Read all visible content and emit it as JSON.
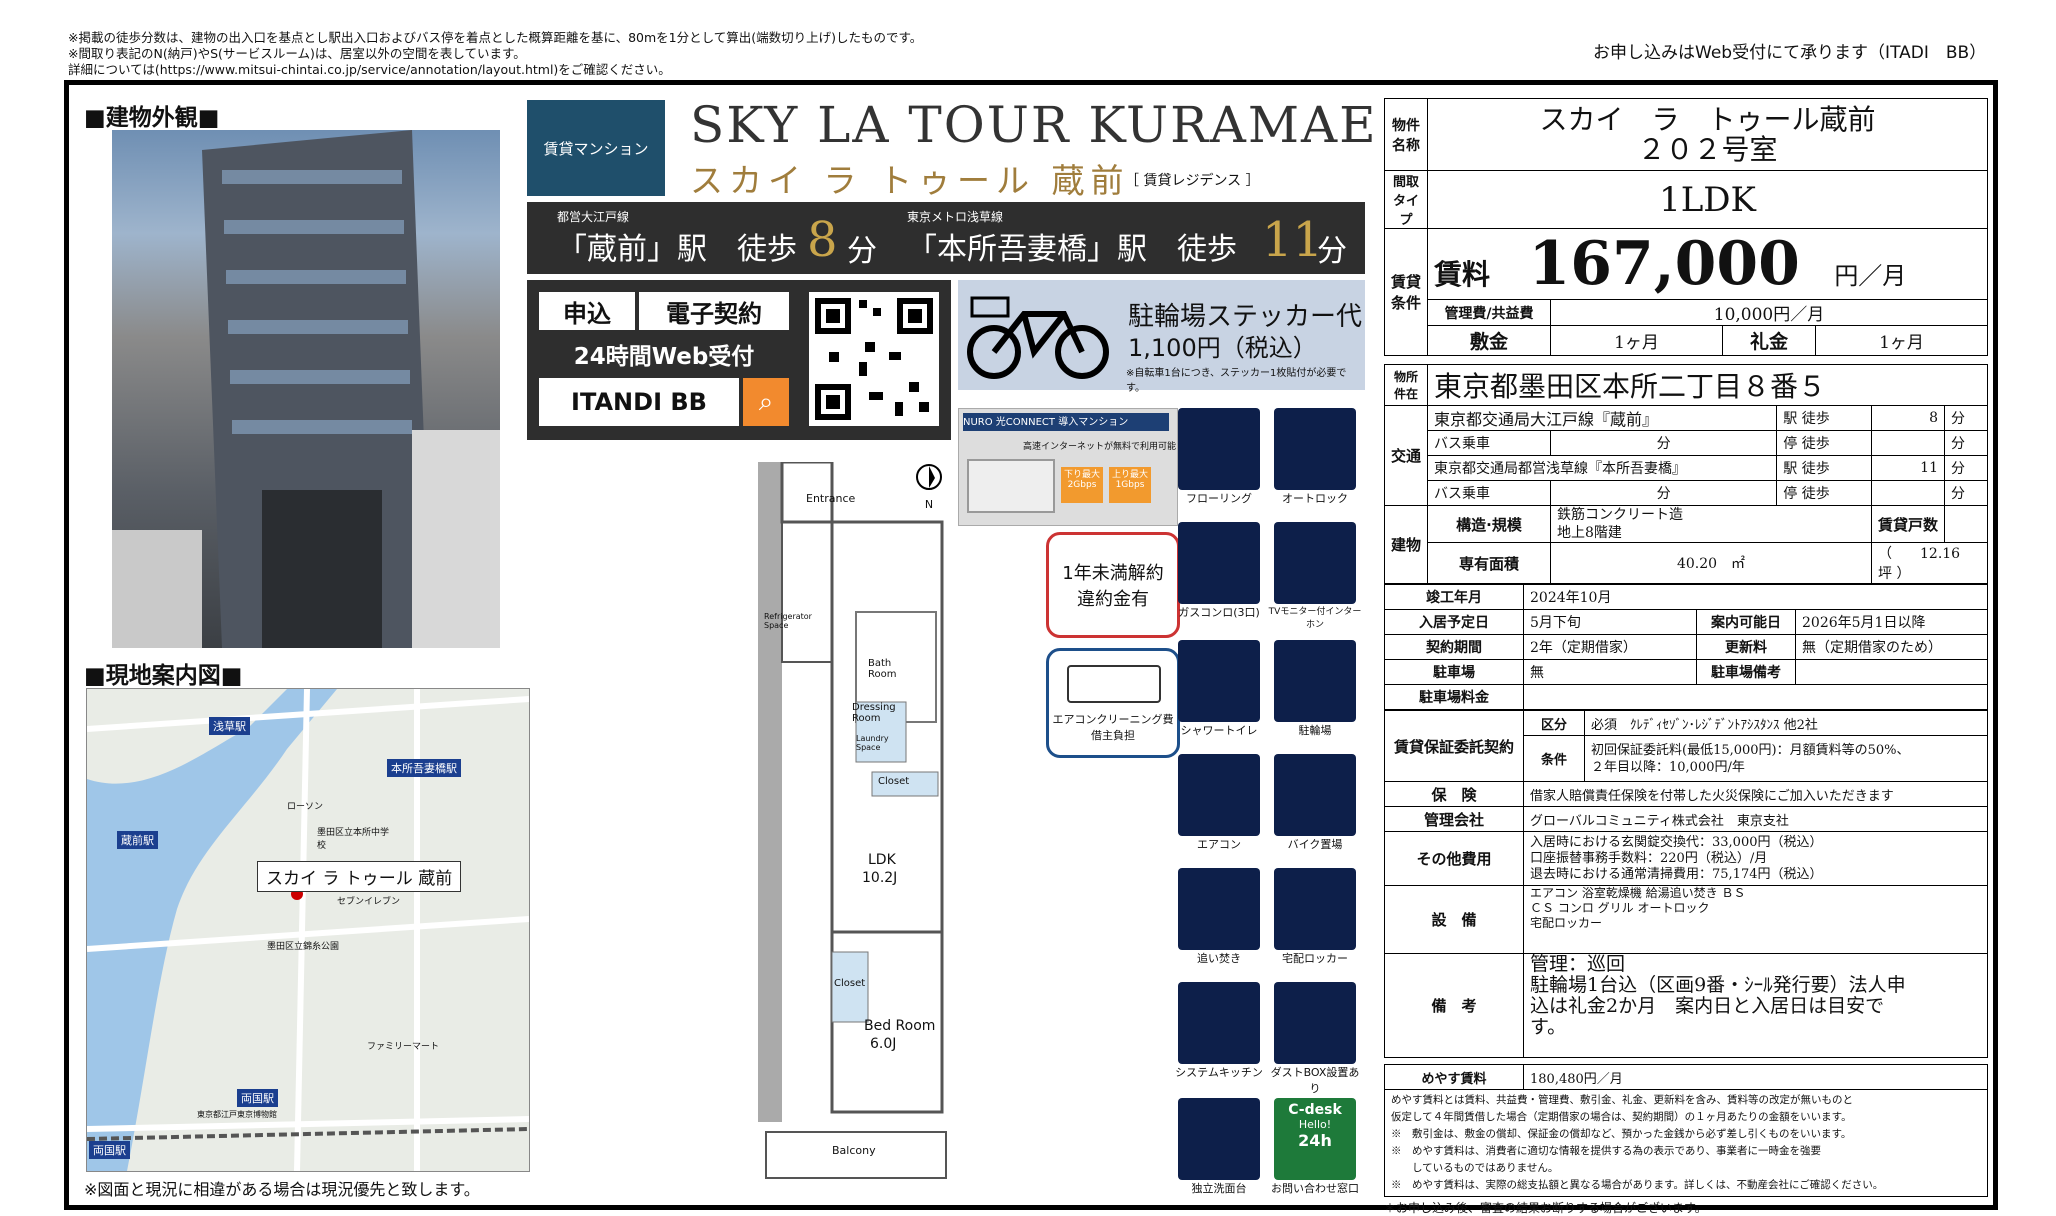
{
  "top_notes": [
    "※掲載の徒歩分数は、建物の出入口を基点とし駅出入口およびバス停を着点とした概算距離を基に、80mを1分として算出(端数切り上げ)したものです。",
    "※間取り表記のN(納戸)やS(サービスルーム)は、居室以外の空間を表しています。",
    "詳細については(https://www.mitsui-chintai.co.jp/service/annotation/layout.html)をご確認ください。"
  ],
  "top_right": "お申し込みはWeb受付にて承ります（ITADI　BB）",
  "exterior_heading": "■建物外観■",
  "map_heading": "■現地案内図■",
  "map_footnote": "※図面と現況に相違がある場合は現況優先と致します。",
  "map_labels": {
    "asakusabashi": "浅草駅",
    "honjo": "本所吾妻橋駅",
    "kuramae": "蔵前駅",
    "ryogoku1": "両国駅",
    "ryogoku2": "両国駅",
    "building": "スカイ ラ トゥール 蔵前",
    "school": "墨田区立本所中学校",
    "park": "墨田区立錦糸公園",
    "lawson": "ローソン",
    "family": "ファミリーマート",
    "seven": "セブンイレブン",
    "museum": "東京都江戸東京博物館"
  },
  "brand": {
    "tag": "賃貸マンション",
    "title_en": "SKY LA TOUR KURAMAE",
    "title_jp": "スカイ ラ トゥール 蔵前",
    "residence": "［ 賃貸レジデンス ］"
  },
  "access_bar": {
    "line1_small": "都営大江戸線",
    "line1": "「蔵前」駅　徒歩",
    "min1": "8",
    "unit1": "分",
    "line2_small": "東京メトロ浅草線",
    "line2": "「本所吾妻橋」駅　徒歩",
    "min2": "11",
    "unit2": "分"
  },
  "apply": {
    "btn1": "申込",
    "btn2": "電子契約",
    "web": "24時間Web受付",
    "itandi": "ITANDI BB"
  },
  "bike": {
    "title": "駐輪場ステッカー代",
    "price": "1,100円（税込）",
    "note": "※自転車1台につき、ステッカー1枚貼付が必要です。"
  },
  "nuro": {
    "title": "NURO 光CONNECT 導入マンション",
    "sub": "高速インターネットが無料で利用可能",
    "down": "下り最大 2Gbps",
    "up": "上り最大 1Gbps"
  },
  "penalty": "1年未満解約\n違約金有",
  "aircon_note": "エアコンクリーニング費\n借主負担",
  "floorplan": {
    "entrance": "Entrance",
    "fridge": "Refrigerator Space",
    "bath": "Bath Room",
    "dressing": "Dressing Room",
    "laundry": "Laundry Space",
    "closet1": "Closet",
    "ldk": "LDK",
    "ldk_size": "10.2J",
    "closet2": "Closet",
    "bed": "Bed Room",
    "bed_size": "6.0J",
    "balcony": "Balcony",
    "north": "N"
  },
  "features": [
    {
      "label": "フローリング",
      "icon": "flooring-icon"
    },
    {
      "label": "オートロック",
      "icon": "autolock-icon"
    },
    {
      "label": "ガスコンロ(3口)",
      "icon": "gas-stove-icon"
    },
    {
      "label": "TVモニター付インターホン",
      "icon": "intercom-icon"
    },
    {
      "label": "シャワートイレ",
      "icon": "toilet-icon"
    },
    {
      "label": "駐輪場",
      "icon": "bicycle-icon"
    },
    {
      "label": "エアコン",
      "icon": "aircon-icon"
    },
    {
      "label": "バイク置場",
      "icon": "motorbike-icon"
    },
    {
      "label": "追い焚き",
      "icon": "bath-icon"
    },
    {
      "label": "宅配ロッカー",
      "icon": "locker-icon"
    },
    {
      "label": "システムキッチン",
      "icon": "kitchen-icon"
    },
    {
      "label": "ダストBOX設置あり",
      "icon": "dustbox-icon"
    },
    {
      "label": "独立洗面台",
      "icon": "washbasin-icon"
    },
    {
      "label": "お問い合わせ窓口",
      "icon": "cdesk-icon"
    }
  ],
  "cdesk": {
    "name": "C-desk",
    "hello": "Hello!",
    "hours": "24h"
  },
  "info": {
    "name_label": "物件名称",
    "name": "スカイ　ラ　トゥール蔵前",
    "room": "２０２号室",
    "type_label": "間取タイプ",
    "layout": "1LDK",
    "cond_label": "賃貸条件",
    "rent_label": "賃料",
    "rent": "167,000",
    "rent_unit": "円／月",
    "mgmt_label": "管理費/共益費",
    "mgmt": "10,000円／月",
    "deposit_label": "敷金",
    "deposit": "1ヶ月",
    "key_label": "礼金",
    "key": "1ヶ月",
    "addr_label": "物所件在",
    "address": "東京都墨田区本所二丁目８番５",
    "traffic_label": "交通",
    "t1": "東京都交通局大江戸線『蔵前』",
    "t1_station": "駅 徒歩",
    "t1_min": "8",
    "t1_unit": "分",
    "bus1": "バス乗車",
    "bus1_min": "分",
    "bus1_stop": "停 徒歩",
    "bus1_unit": "分",
    "t2": "東京都交通局都営浅草線『本所吾妻橋』",
    "t2_station": "駅 徒歩",
    "t2_min": "11",
    "t2_unit": "分",
    "bus2": "バス乗車",
    "bus2_min": "分",
    "bus2_stop": "停 徒歩",
    "bus2_unit": "分",
    "bldg_label": "建物",
    "struct_label": "構造·規模",
    "struct": "鉄筋コンクリート造",
    "floors": "地上8階建",
    "units_label": "賃貸戸数",
    "units": "",
    "area_label": "専有面積",
    "area": "40.20　㎡",
    "tsubo": "（　　12.16　坪 ）",
    "built_label": "竣工年月",
    "built": "2024年10月",
    "move_label": "入居予定日",
    "move": "5月下旬",
    "guide_label": "案内可能日",
    "guide": "2026年5月1日以降",
    "term_label": "契約期間",
    "term": "2年（定期借家）",
    "renew_label": "更新料",
    "renew": "無（定期借家のため）",
    "parking_label": "駐車場",
    "parking": "無",
    "parking_note_label": "駐車場備考",
    "parking_fee_label": "駐車場料金",
    "guarantee_label": "賃貸保証委託契約",
    "g_kubun": "区分",
    "g_kubun_val": "必須　ｸﾚﾃﾞｨｾｿﾞﾝ･ﾚｼﾞﾃﾞﾝﾄｱｼｽﾀﾝｽ 他2社",
    "g_cond": "条件",
    "g_cond_val1": "初回保証委託料(最低15,000円)：月額賃料等の50%、",
    "g_cond_val2": "２年目以降：10,000円/年",
    "ins_label": "保　険",
    "ins": "借家人賠償責任保険を付帯した火災保険にご加入いただきます",
    "mgr_label": "管理会社",
    "mgr": "グローバルコミュニティ株式会社　東京支社",
    "other_label": "その他費用",
    "other1": "入居時における玄関錠交換代：33,000円（税込）",
    "other2": "口座振替事務手数料：220円（税込）/月",
    "other3": "退去時における通常清掃費用：75,174円（税込）",
    "equip_label": "設　備",
    "equip1": "エアコン 浴室乾燥機 給湯追い焚き ＢＳ",
    "equip2": "ＣＳ コンロ グリル オートロック",
    "equip3": "宅配ロッカー",
    "remarks_label": "備　考",
    "remarks1": "管理：巡回",
    "remarks2": "駐輪場1台込（区画9番・ｼｰﾙ発行要）法人申",
    "remarks3": "込は礼金2か月　案内日と入居日は目安で",
    "remarks4": "す。",
    "yasu_label": "めやす賃料",
    "yasu": "180,480円／月",
    "yasu_notes": [
      "めやす賃料とは賃料、共益費・管理費、敷引金、礼金、更新料を含み、賃料等の改定が無いものと",
      "仮定して４年間賃借した場合（定期借家の場合は、契約期間）の１ヶ月あたりの金額をいいます。",
      "※　敷引金は、敷金の償却、保証金の償却など、預かった金銭から必ず差し引くものをいいます。",
      "※　めやす賃料は、消費者に適切な情報を提供する為の表示であり、事業者に一時金を強要",
      "　　しているものではありません。",
      "※　めやす賃料は、実際の総支払額と異なる場合があります。詳しくは、不動産会社にご確認ください。"
    ],
    "bottom_note": "＊お申し込み後、審査の結果お断りする場合がございます。"
  }
}
